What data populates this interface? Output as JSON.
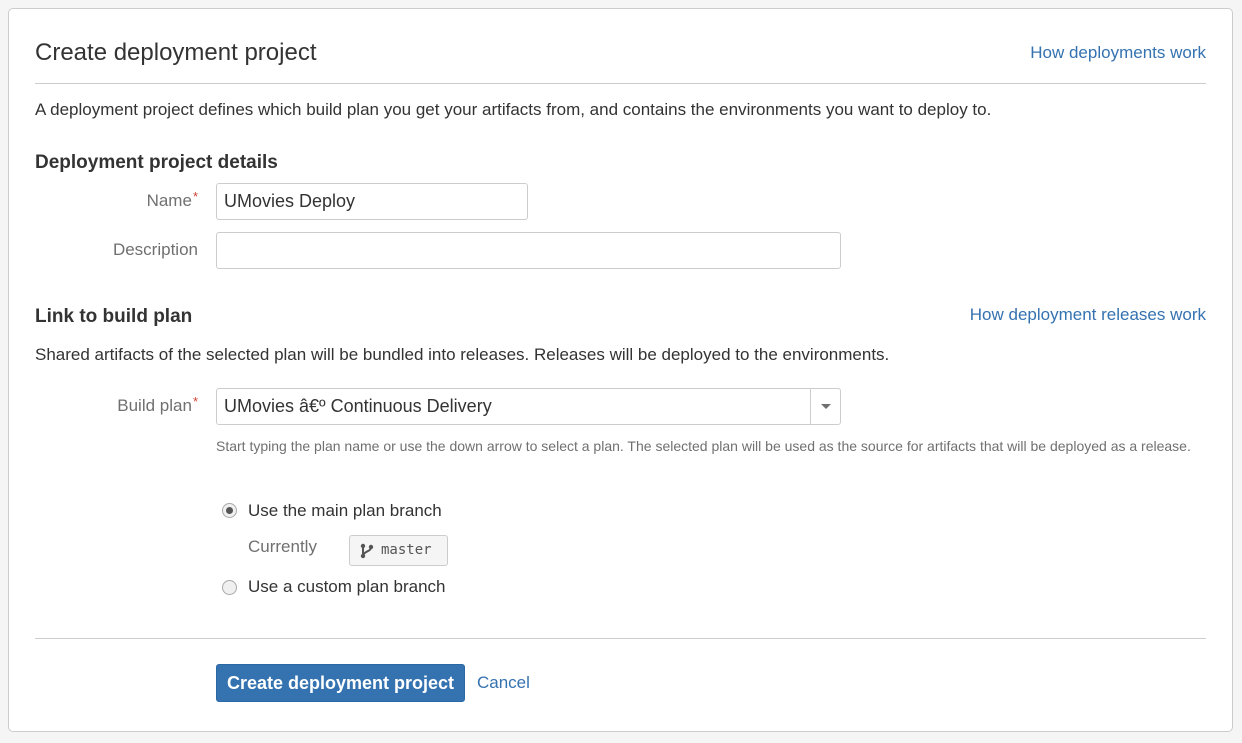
{
  "header": {
    "title": "Create deployment project",
    "help_link": "How deployments work"
  },
  "intro": "A deployment project defines which build plan you get your artifacts from, and contains the environments you want to deploy to.",
  "details": {
    "heading": "Deployment project details",
    "name_label": "Name",
    "required_marker": "*",
    "name_value": "UMovies Deploy",
    "description_label": "Description",
    "description_value": ""
  },
  "build_plan_section": {
    "heading": "Link to build plan",
    "help_link": "How deployment releases work",
    "description": "Shared artifacts of the selected plan will be bundled into releases. Releases will be deployed to the environments.",
    "build_plan_label": "Build plan",
    "required_marker": "*",
    "selected_plan": "UMovies â€º Continuous Delivery",
    "help_text": "Start typing the plan name or use the down arrow to select a plan. The selected plan will be used as the source for artifacts that will be deployed as a release.",
    "branch_options": [
      {
        "label": "Use the main plan branch",
        "checked": true
      },
      {
        "label": "Use a custom plan branch",
        "checked": false
      }
    ],
    "currently_label": "Currently",
    "current_branch": "master"
  },
  "actions": {
    "submit_label": "Create deployment project",
    "cancel_label": "Cancel"
  },
  "colors": {
    "link": "#3572b0",
    "primary_button": "#3572b0",
    "required": "#d04437",
    "border": "#cccccc"
  },
  "icons": {
    "branch": "branch-icon",
    "dropdown": "caret-down-icon"
  }
}
